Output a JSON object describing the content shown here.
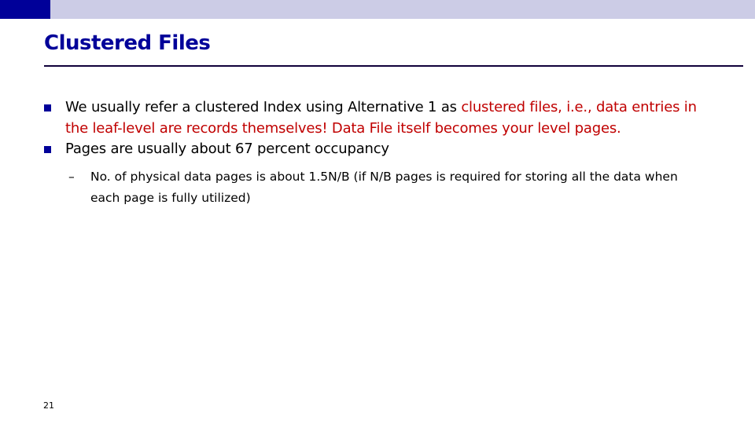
{
  "slide": {
    "title": "Clustered Files",
    "bullets": [
      {
        "text_black": "We usually refer a clustered Index using Alternative 1 as ",
        "text_red": "clustered files, i.e., data entries in the leaf-level are records themselves! Data File itself becomes your level pages."
      },
      {
        "text_black": "Pages are usually about 67 percent occupancy",
        "sub_bullets": [
          {
            "dash": "–",
            "text": "No. of physical data pages is about 1.5N/B (if N/B pages is required for storing all the data when each page is fully utilized)"
          }
        ]
      }
    ],
    "page_number": "21"
  },
  "colors": {
    "title": "#000099",
    "emphasis": "#c00000",
    "topbar": "#ccccE6",
    "topbar_block": "#000099"
  }
}
